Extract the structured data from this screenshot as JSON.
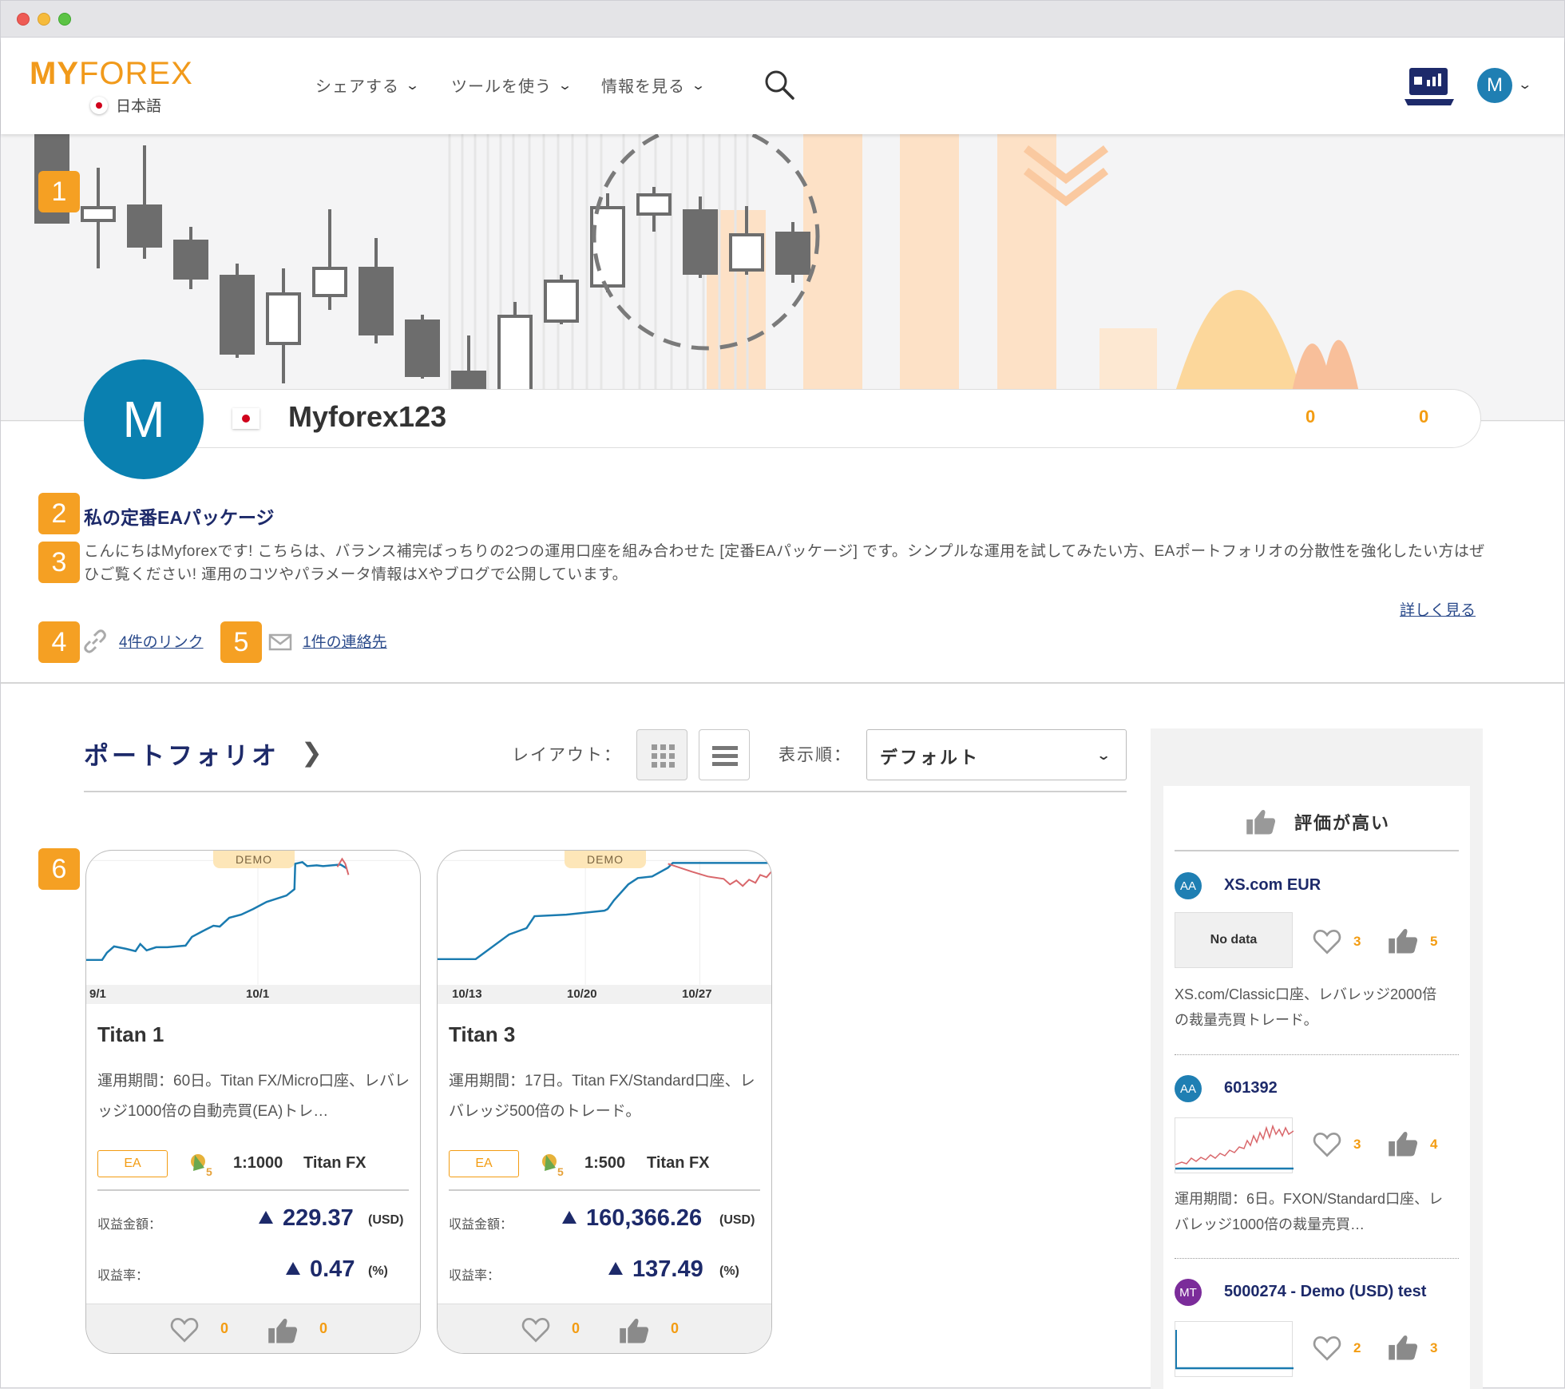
{
  "header": {
    "logo_my": "MY",
    "logo_forex": "FOREX",
    "language": "日本語",
    "nav": [
      "シェアする",
      "ツールを使う",
      "情報を見る"
    ],
    "user_initial": "M"
  },
  "badges": [
    "1",
    "2",
    "3",
    "4",
    "5",
    "6"
  ],
  "profile": {
    "initial": "M",
    "name": "Myforex123",
    "favorites": "0",
    "likes": "0"
  },
  "package": {
    "title": "私の定番EAパッケージ",
    "description": "こんにちはMyforexです! こちらは、バランス補完ばっちりの2つの運用口座を組み合わせた [定番EAパッケージ] です。シンプルな運用を試してみたい方、EAポートフォリオの分散性を強化したい方はぜひご覧ください! 運用のコツやパラメータ情報はXやブログで公開しています。",
    "more": "詳しく見る",
    "links": "4件のリンク",
    "contacts": "1件の連絡先"
  },
  "portfolio": {
    "title": "ポートフォリオ",
    "layout_label": "レイアウト：",
    "sort_label": "表示順：",
    "sort_value": "デフォルト"
  },
  "cards": [
    {
      "tag": "DEMO",
      "x_ticks": [
        "9/1",
        "10/1"
      ],
      "title": "Titan 1",
      "description": "運用期間：60日。Titan FX/Micro口座、レバレッジ1000倍の自動売買(EA)トレ…",
      "type": "EA",
      "leverage": "1:1000",
      "broker": "Titan FX",
      "profit_label": "収益金額：",
      "profit": "229.37",
      "profit_unit": "(USD)",
      "rate_label": "収益率：",
      "rate": "0.47",
      "rate_unit": "(%)",
      "favorites": "0",
      "likes": "0"
    },
    {
      "tag": "DEMO",
      "x_ticks": [
        "10/13",
        "10/20",
        "10/27"
      ],
      "title": "Titan 3",
      "description": "運用期間：17日。Titan FX/Standard口座、レバレッジ500倍のトレード。",
      "type": "EA",
      "leverage": "1:500",
      "broker": "Titan FX",
      "profit_label": "収益金額：",
      "profit": "160,366.26",
      "profit_unit": "(USD)",
      "rate_label": "収益率：",
      "rate": "137.49",
      "rate_unit": "(%)",
      "favorites": "0",
      "likes": "0"
    }
  ],
  "sidebar": {
    "title": "評価が高い",
    "items": [
      {
        "avatar": "AA",
        "name": "XS.com EUR",
        "thumb": "No data",
        "favorites": "3",
        "likes": "5",
        "description": "XS.com/Classic口座、レバレッジ2000倍の裁量売買トレード。"
      },
      {
        "avatar": "AA",
        "name": "601392",
        "favorites": "3",
        "likes": "4",
        "description": "運用期間：6日。FXON/Standard口座、レバレッジ1000倍の裁量売買…"
      },
      {
        "avatar": "MT",
        "name": "5000274 - Demo (USD) test",
        "favorites": "2",
        "likes": "3"
      }
    ]
  },
  "colors": {
    "accent": "#f5a023",
    "navy": "#1d2a6a",
    "avatar_blue": "#0a80b0",
    "chart_line": "#1a7bb0",
    "chart_loss": "#d9676b"
  }
}
